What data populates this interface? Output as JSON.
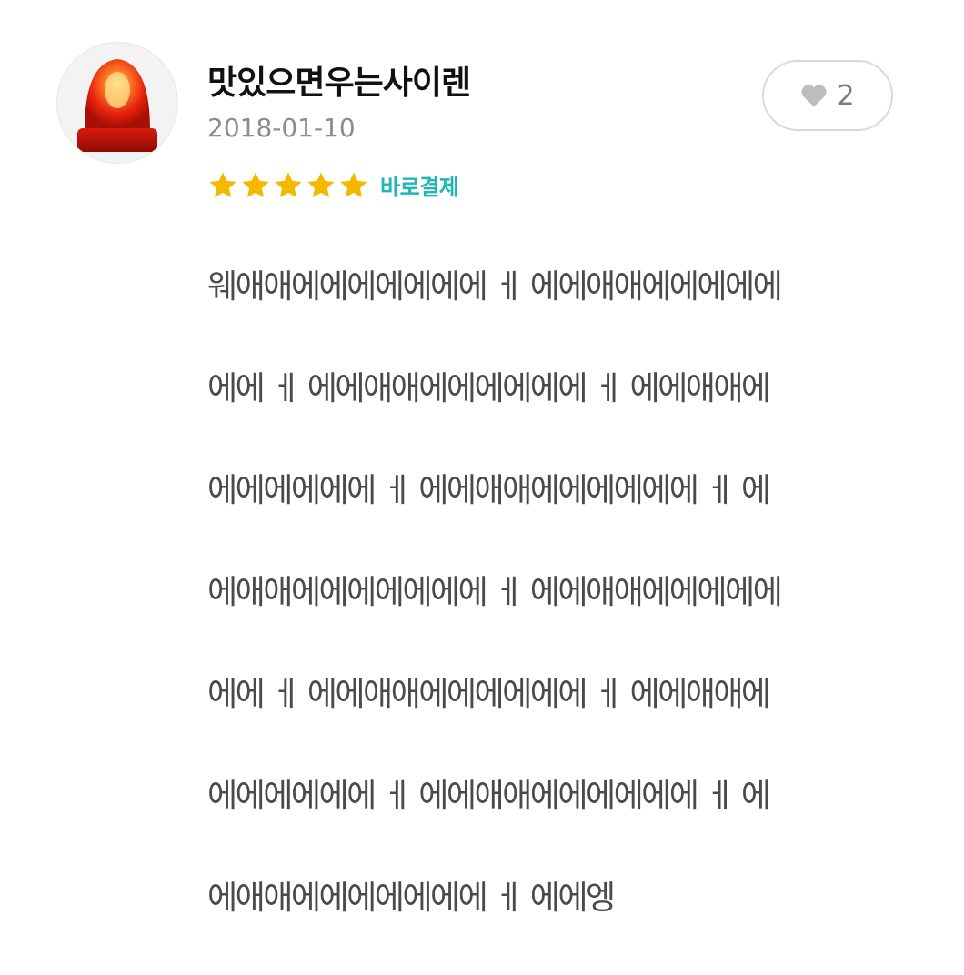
{
  "review": {
    "username": "맛있으면우는사이렌",
    "date": "2018-01-10",
    "like_count": "2",
    "rating": 5,
    "purchase_label": "바로결제",
    "body_lines": [
      "웨애애에에에에에에에 ㅔ 에에애애에에에에에",
      "에에 ㅔ 에에애애에에에에에에 ㅔ 에에애애에",
      "에에에에에에 ㅔ 에에애애에에에에에에 ㅔ 에",
      "에애애에에에에에에에 ㅔ 에에애애에에에에에",
      "에에 ㅔ 에에애애에에에에에에 ㅔ 에에애애에",
      "에에에에에에 ㅔ 에에애애에에에에에에 ㅔ 에",
      "에애애에에에에에에에 ㅔ 에에엥"
    ]
  },
  "icons": {
    "avatar": "siren-icon",
    "like": "heart-icon",
    "star": "star-icon"
  },
  "colors": {
    "star": "#f5b800",
    "purchase_label": "#1fb6b6",
    "siren_red": "#e8220e"
  }
}
